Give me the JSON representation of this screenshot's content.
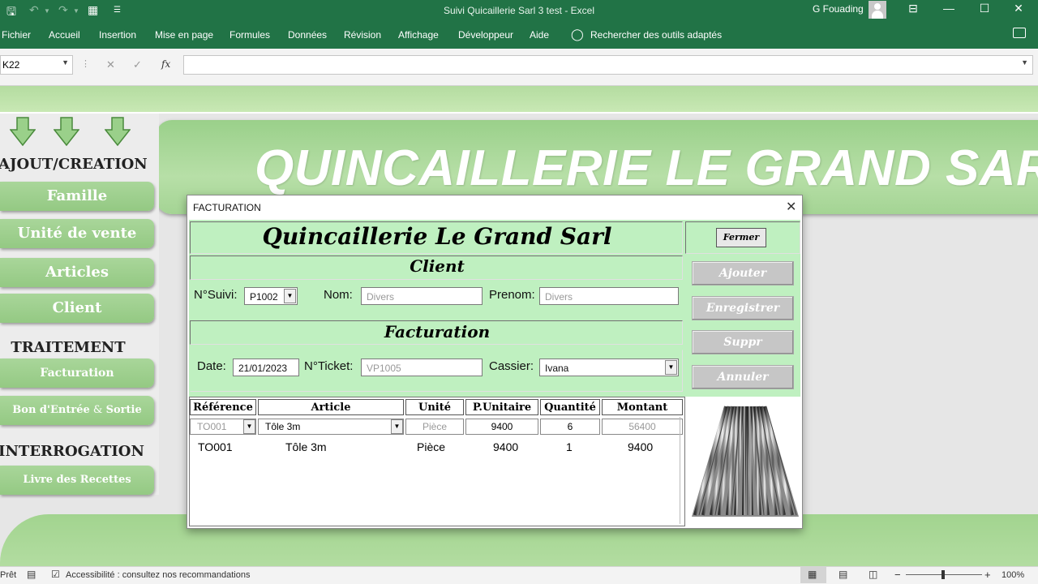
{
  "window": {
    "title": "Suivi Quicaillerie Sarl 3 test  -  Excel",
    "user": "G Fouading"
  },
  "ribbon": {
    "tabs": [
      "Fichier",
      "Accueil",
      "Insertion",
      "Mise en page",
      "Formules",
      "Données",
      "Révision",
      "Affichage",
      "Développeur",
      "Aide"
    ],
    "search": "Rechercher des outils adaptés"
  },
  "formula_bar": {
    "name_box": "K22",
    "formula": ""
  },
  "sheet": {
    "banner_title": "QUINCAILLERIE LE GRAND SARL",
    "sections": {
      "ajout": "AJOUT/CREATION",
      "traitement": "TRAITEMENT",
      "interrogation": "INTERROGATION"
    },
    "buttons": {
      "famille": "Famille",
      "unite": "Unité de vente",
      "articles": "Articles",
      "client": "Client",
      "facturation": "Facturation",
      "bon_a": "Bon d'Entrée",
      "bon_amp": " & ",
      "bon_b": "Sortie",
      "livre": "Livre des Recettes"
    },
    "accent_color": "#a9d69a"
  },
  "dialog": {
    "title": "FACTURATION",
    "company": "Quincaillerie Le Grand Sarl",
    "fermer": "Fermer",
    "client_header": "Client",
    "facturation_header": "Facturation",
    "suivi": {
      "label": "N°Suivi:",
      "value": "P1002"
    },
    "nom": {
      "label": "Nom:",
      "value": "Divers"
    },
    "prenom": {
      "label": "Prenom:",
      "value": "Divers"
    },
    "date": {
      "label": "Date:",
      "value": "21/01/2023"
    },
    "ticket": {
      "label": "N°Ticket:",
      "value": "VP1005"
    },
    "cassier": {
      "label": "Cassier:",
      "value": "Ivana"
    },
    "actions": {
      "ajouter": "Ajouter",
      "enregistrer": "Enregistrer",
      "suppr": "Suppr",
      "annuler": "Annuler"
    },
    "columns": [
      "Référence",
      "Article",
      "Unité",
      "P.Unitaire",
      "Quantité",
      "Montant"
    ],
    "entry": {
      "reference": "TO001",
      "article": "Tôle 3m",
      "unite": "Pièce",
      "prix": "9400",
      "quantite": "6",
      "montant": "56400"
    },
    "rows": [
      {
        "reference": "TO001",
        "article": "Tôle 3m",
        "unite": "Pièce",
        "prix": "9400",
        "quantite": "1",
        "montant": "9400"
      }
    ],
    "bg_color": "#bff0c0"
  },
  "status": {
    "ready": "Prêt",
    "accessibility": "Accessibilité : consultez nos recommandations",
    "zoom": "100%"
  }
}
